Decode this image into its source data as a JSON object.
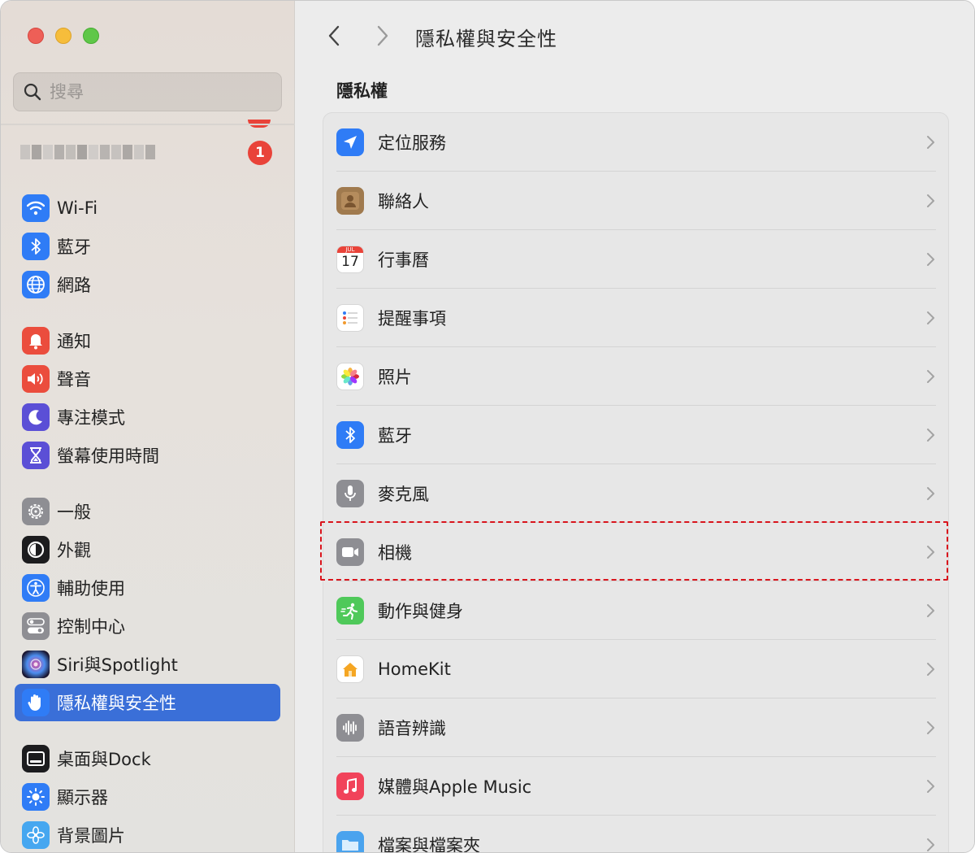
{
  "sidebar": {
    "search_placeholder": "搜尋",
    "account_badge": "1",
    "items": [
      {
        "label": "Wi-Fi",
        "icon": "wifi-icon",
        "color": "#2f7cf6"
      },
      {
        "label": "藍牙",
        "icon": "bluetooth-icon",
        "color": "#2f7cf6"
      },
      {
        "label": "網路",
        "icon": "globe-icon",
        "color": "#2f7cf6"
      },
      {
        "label": "通知",
        "icon": "bell-icon",
        "color": "#eb4d3d"
      },
      {
        "label": "聲音",
        "icon": "speaker-icon",
        "color": "#eb4d3d"
      },
      {
        "label": "專注模式",
        "icon": "moon-icon",
        "color": "#5b4fd6"
      },
      {
        "label": "螢幕使用時間",
        "icon": "hourglass-icon",
        "color": "#5b4fd6"
      },
      {
        "label": "一般",
        "icon": "gear-icon",
        "color": "#8e8e93"
      },
      {
        "label": "外觀",
        "icon": "appearance-icon",
        "color": "#1c1c1e"
      },
      {
        "label": "輔助使用",
        "icon": "accessibility-icon",
        "color": "#2f7cf6"
      },
      {
        "label": "控制中心",
        "icon": "toggles-icon",
        "color": "#8e8e93"
      },
      {
        "label": "Siri與Spotlight",
        "icon": "siri-icon",
        "color": "#3b2f6b"
      },
      {
        "label": "隱私權與安全性",
        "icon": "hand-icon",
        "color": "#2f7cf6",
        "active": true
      },
      {
        "label": "桌面與Dock",
        "icon": "dock-icon",
        "color": "#1c1c1e"
      },
      {
        "label": "顯示器",
        "icon": "sun-icon",
        "color": "#2f7cf6"
      },
      {
        "label": "背景圖片",
        "icon": "flower-icon",
        "color": "#46a7f0"
      }
    ]
  },
  "header": {
    "title": "隱私權與安全性"
  },
  "main": {
    "section_title": "隱私權",
    "rows": [
      {
        "label": "定位服務",
        "icon": "location-arrow-icon",
        "color": "#2f7cf6"
      },
      {
        "label": "聯絡人",
        "icon": "contacts-icon",
        "color": "#a07a4e"
      },
      {
        "label": "行事曆",
        "icon": "calendar-icon",
        "color": "#ffffff",
        "cal_month": "JUL",
        "cal_day": "17"
      },
      {
        "label": "提醒事項",
        "icon": "reminders-icon",
        "color": "#ffffff"
      },
      {
        "label": "照片",
        "icon": "photos-icon",
        "color": "#ffffff"
      },
      {
        "label": "藍牙",
        "icon": "bluetooth-icon",
        "color": "#2f7cf6"
      },
      {
        "label": "麥克風",
        "icon": "microphone-icon",
        "color": "#8e8e93"
      },
      {
        "label": "相機",
        "icon": "camera-icon",
        "color": "#8e8e93"
      },
      {
        "label": "動作與健身",
        "icon": "fitness-icon",
        "color": "#4fc95a"
      },
      {
        "label": "HomeKit",
        "icon": "home-icon",
        "color": "#ffffff"
      },
      {
        "label": "語音辨識",
        "icon": "waveform-icon",
        "color": "#8e8e93"
      },
      {
        "label": "媒體與Apple Music",
        "icon": "music-note-icon",
        "color": "#f1435a"
      },
      {
        "label": "檔案與檔案夾",
        "icon": "folder-icon",
        "color": "#4aa3ee"
      }
    ]
  }
}
